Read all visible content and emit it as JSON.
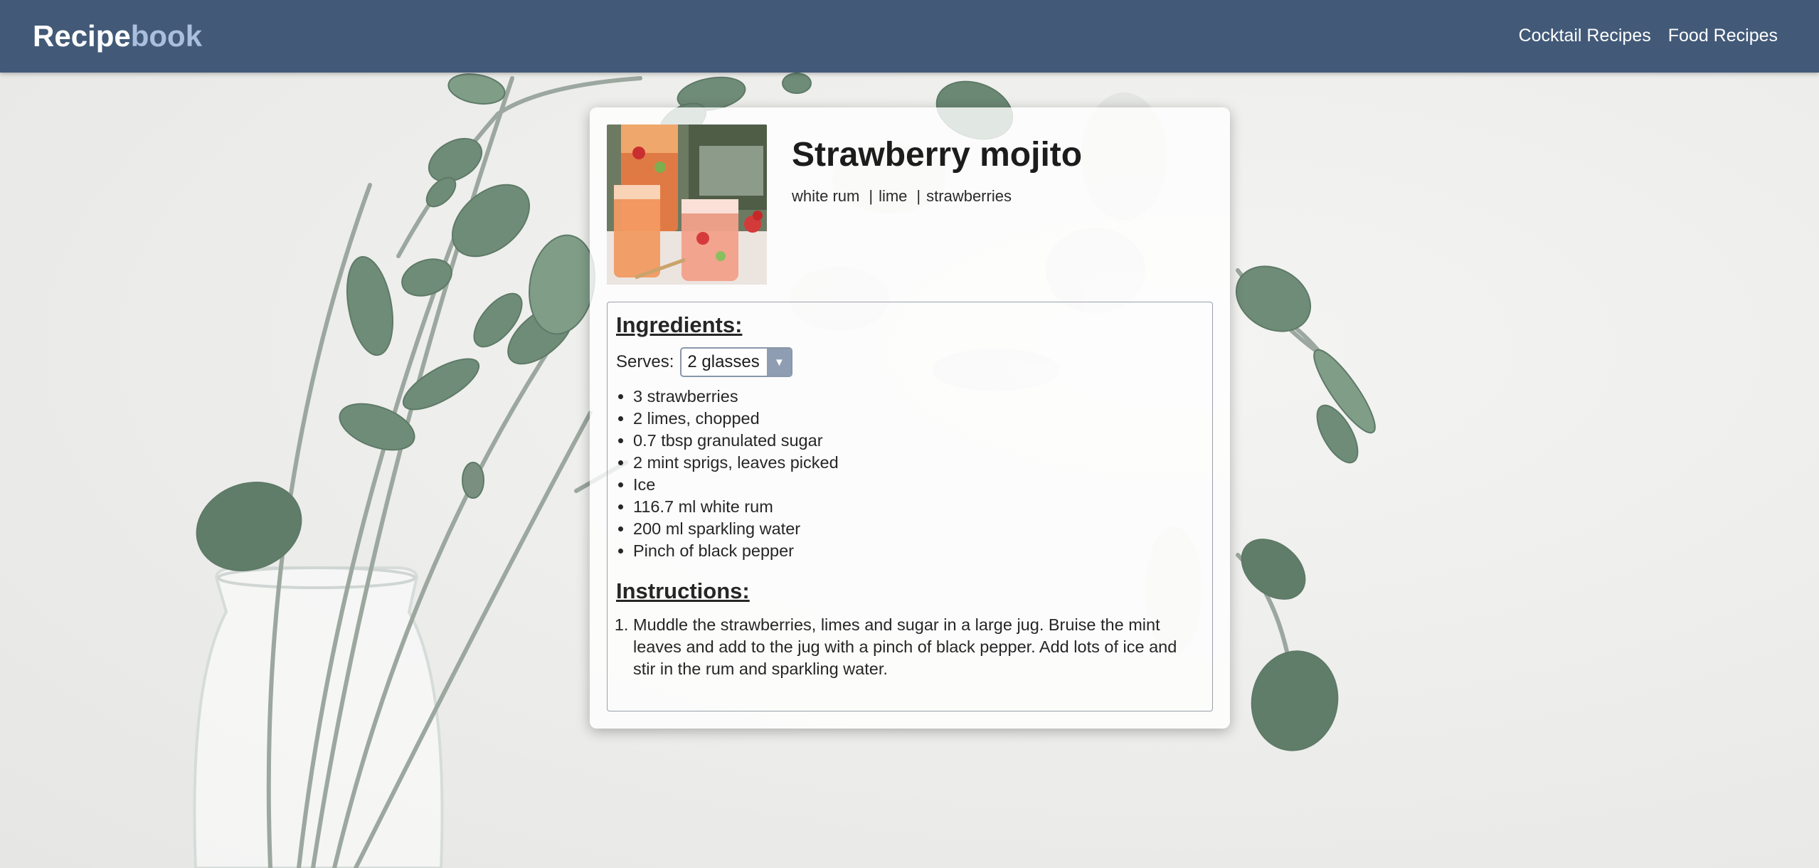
{
  "navbar": {
    "brand_part1": "Recipe",
    "brand_part2": "book",
    "links": [
      "Cocktail Recipes",
      "Food Recipes"
    ]
  },
  "recipe": {
    "title": "Strawberry mojito",
    "tags": [
      "white rum",
      "lime",
      "strawberries"
    ],
    "tag_separator": "|",
    "ingredients_heading": "Ingredients:",
    "serves_label": "Serves:",
    "serves_selected": "2 glasses",
    "ingredients": [
      "3 strawberries",
      "2 limes, chopped",
      "0.7 tbsp granulated sugar",
      "2 mint sprigs, leaves picked",
      "Ice",
      "116.7 ml white rum",
      "200 ml sparkling water",
      "Pinch of black pepper"
    ],
    "instructions_heading": "Instructions:",
    "instructions": [
      "Muddle the strawberries, limes and sugar in a large jug. Bruise the mint leaves and add to the jug with a pinch of black pepper. Add lots of ice and stir in the rum and sparkling water."
    ]
  },
  "colors": {
    "navbar_bg": "#425a78",
    "brand_accent": "#a9bfdd",
    "select_arrow_bg": "#8e9db1"
  },
  "icons": {
    "select_arrow": "chevron-down-icon"
  }
}
